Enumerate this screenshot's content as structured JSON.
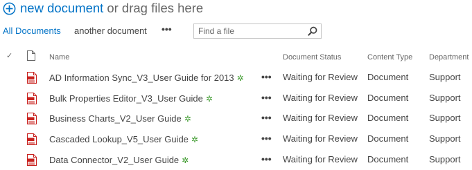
{
  "new_document": {
    "link_text": "new document",
    "rest_text": "or drag files here"
  },
  "views": {
    "all_documents": "All Documents",
    "another_document": "another document",
    "more": "•••"
  },
  "search": {
    "placeholder": "Find a file"
  },
  "columns": {
    "check": "✓",
    "name": "Name",
    "status": "Document Status",
    "type": "Content Type",
    "department": "Department"
  },
  "row_more": "•••",
  "new_badge": "✲",
  "rows": [
    {
      "name": "AD Information Sync_V3_User Guide for 2013",
      "status": "Waiting for Review",
      "type": "Document",
      "department": "Support"
    },
    {
      "name": "Bulk Properties Editor_V3_User Guide",
      "status": "Waiting for Review",
      "type": "Document",
      "department": "Support"
    },
    {
      "name": "Business Charts_V2_User Guide",
      "status": "Waiting for Review",
      "type": "Document",
      "department": "Support"
    },
    {
      "name": "Cascaded Lookup_V5_User Guide",
      "status": "Waiting for Review",
      "type": "Document",
      "department": "Support"
    },
    {
      "name": "Data Connector_V2_User Guide",
      "status": "Waiting for Review",
      "type": "Document",
      "department": "Support"
    }
  ],
  "colors": {
    "accent": "#0072c6",
    "new_badge": "#3f9b2f",
    "pdf_icon": "#c8211e"
  }
}
